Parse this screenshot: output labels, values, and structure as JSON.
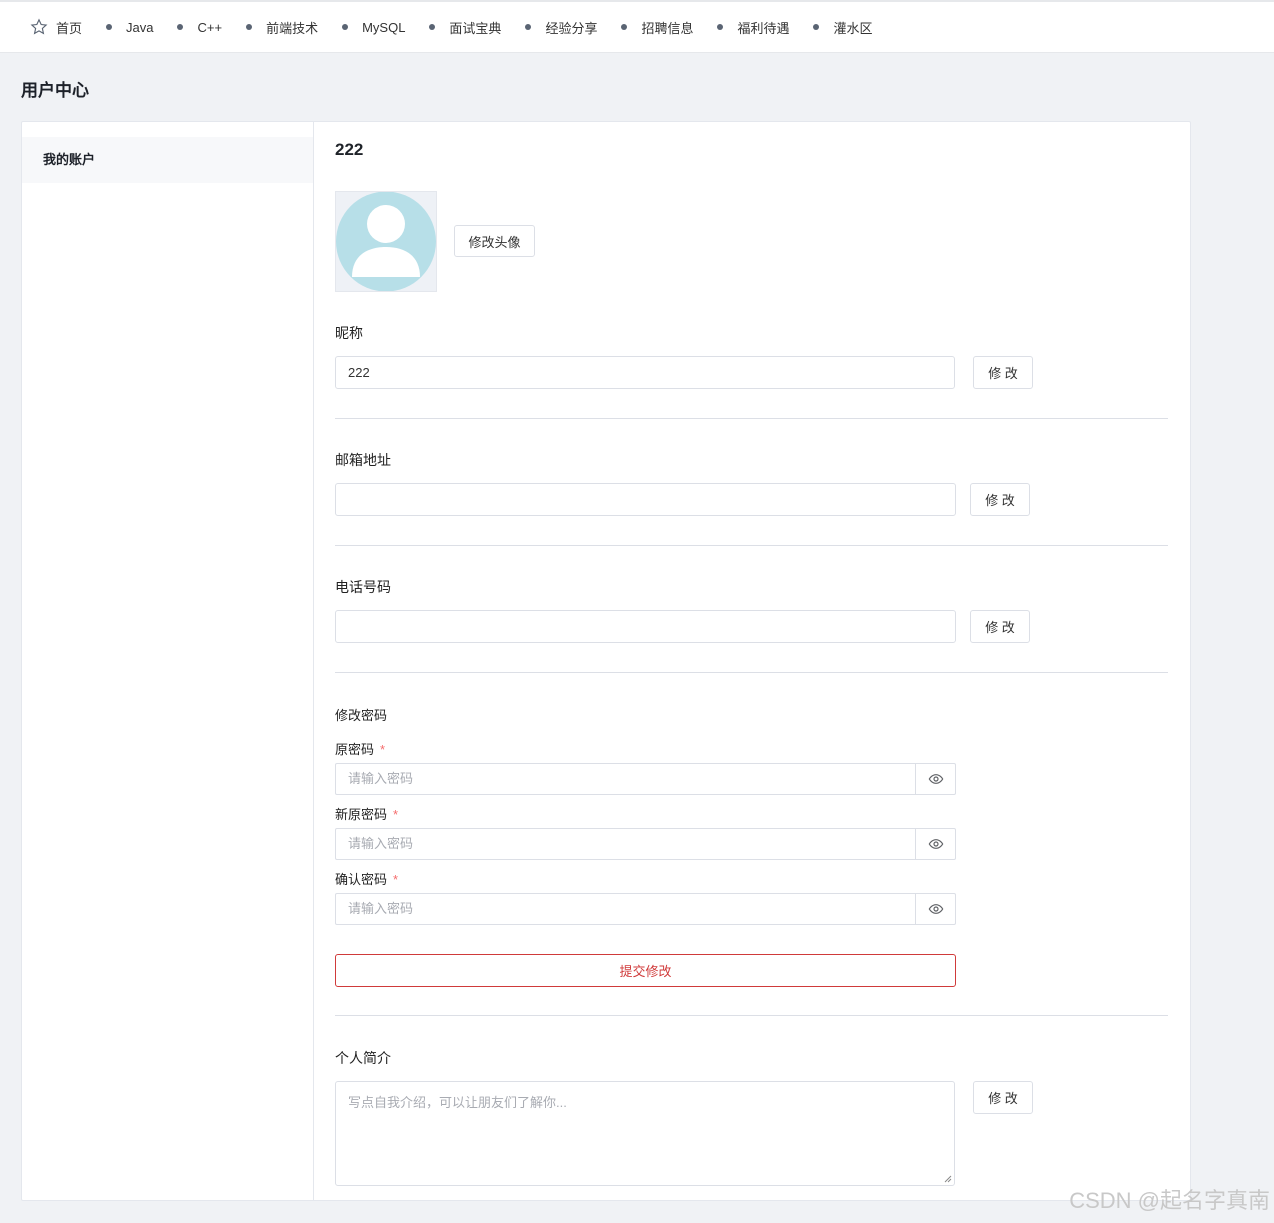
{
  "nav": {
    "items": [
      {
        "label": "首页",
        "icon": "star-icon"
      },
      {
        "label": "Java"
      },
      {
        "label": "C++"
      },
      {
        "label": "前端技术"
      },
      {
        "label": "MySQL"
      },
      {
        "label": "面试宝典"
      },
      {
        "label": "经验分享"
      },
      {
        "label": "招聘信息"
      },
      {
        "label": "福利待遇"
      },
      {
        "label": "灌水区"
      }
    ]
  },
  "page": {
    "title": "用户中心"
  },
  "sidebar": {
    "items": [
      {
        "label": "我的账户"
      }
    ]
  },
  "profile": {
    "username": "222",
    "avatar_icon": "user-avatar-icon",
    "change_avatar_label": "修改头像",
    "nickname": {
      "label": "昵称",
      "value": "222",
      "button": "修 改"
    },
    "email": {
      "label": "邮箱地址",
      "value": "",
      "button": "修 改"
    },
    "phone": {
      "label": "电话号码",
      "value": "",
      "button": "修 改"
    },
    "password": {
      "section_label": "修改密码",
      "old": {
        "label": "原密码",
        "placeholder": "请输入密码"
      },
      "new": {
        "label": "新原密码",
        "placeholder": "请输入密码"
      },
      "confirm": {
        "label": "确认密码",
        "placeholder": "请输入密码"
      },
      "required_mark": "*",
      "submit_label": "提交修改"
    },
    "bio": {
      "label": "个人简介",
      "placeholder": "写点自我介绍，可以让朋友们了解你...",
      "button": "修 改"
    }
  },
  "watermark": "CSDN @起名字真南",
  "colors": {
    "accent_red": "#d03a3a",
    "avatar_bg": "#b7dfe8"
  }
}
